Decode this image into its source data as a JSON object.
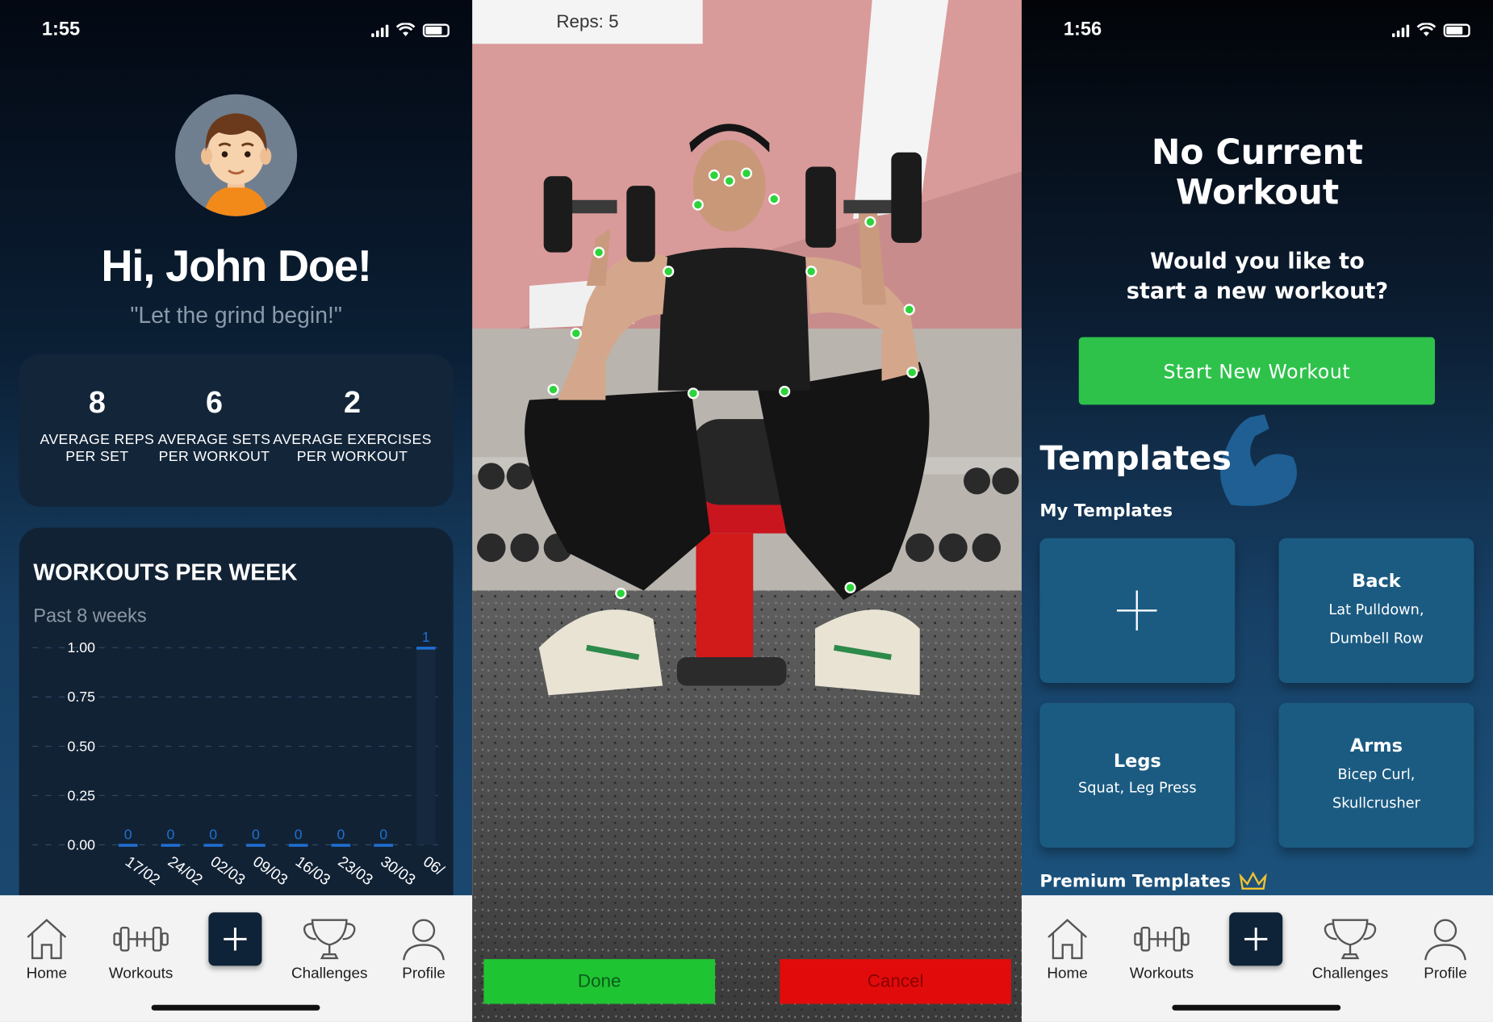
{
  "home_screen": {
    "status_time": "1:55",
    "greeting": "Hi, John Doe!",
    "motto": "\"Let the grind begin!\"",
    "stats": [
      {
        "value": "8",
        "label_line1": "AVERAGE REPS",
        "label_line2": "PER SET"
      },
      {
        "value": "6",
        "label_line1": "AVERAGE SETS",
        "label_line2": "PER WORKOUT"
      },
      {
        "value": "2",
        "label_line1": "AVERAGE EXERCISES",
        "label_line2": "PER WORKOUT"
      }
    ],
    "workouts_card": {
      "title": "WORKOUTS PER WEEK",
      "subtitle": "Past 8 weeks"
    }
  },
  "chart_data": {
    "type": "bar",
    "title": "WORKOUTS PER WEEK",
    "subtitle": "Past 8 weeks",
    "categories": [
      "17/02",
      "24/02",
      "02/03",
      "09/03",
      "16/03",
      "23/03",
      "30/03",
      "06/"
    ],
    "values": [
      0,
      0,
      0,
      0,
      0,
      0,
      0,
      1
    ],
    "y_ticks": [
      "1.00",
      "0.75",
      "0.50",
      "0.25",
      "0.00"
    ],
    "ylim": [
      0,
      1
    ],
    "grid": "dashed horizontal",
    "bar_color": "#1f6fd1"
  },
  "nav": {
    "home": "Home",
    "workouts": "Workouts",
    "add": "+",
    "challenges": "Challenges",
    "profile": "Profile"
  },
  "camera_screen": {
    "reps_label": "Reps: 5",
    "done_label": "Done",
    "cancel_label": "Cancel"
  },
  "workout_screen": {
    "status_time": "1:56",
    "title": "No Current Workout",
    "question": "Would you like to start a new workout?",
    "start_button": "Start New Workout",
    "templates_title": "Templates",
    "my_templates_label": "My Templates",
    "add_template_symbol": "+",
    "templates": [
      {
        "name": "Back",
        "exercises_line1": "Lat Pulldown,",
        "exercises_line2": "Dumbell Row"
      },
      {
        "name": "Legs",
        "exercises_line1": "Squat, Leg Press",
        "exercises_line2": ""
      },
      {
        "name": "Arms",
        "exercises_line1": "Bicep Curl,",
        "exercises_line2": "Skullcrusher"
      }
    ],
    "premium_label": "Premium Templates"
  },
  "colors": {
    "accent_green": "#2ec24b",
    "done_green": "#1fc433",
    "cancel_red": "#e20b0b",
    "card_blue": "#1b5b82",
    "dark_navy": "#0f2338"
  },
  "icons": [
    "home-icon",
    "dumbbell-icon",
    "plus-icon",
    "trophy-icon",
    "profile-icon",
    "crown-icon",
    "flexed-arm-icon"
  ]
}
